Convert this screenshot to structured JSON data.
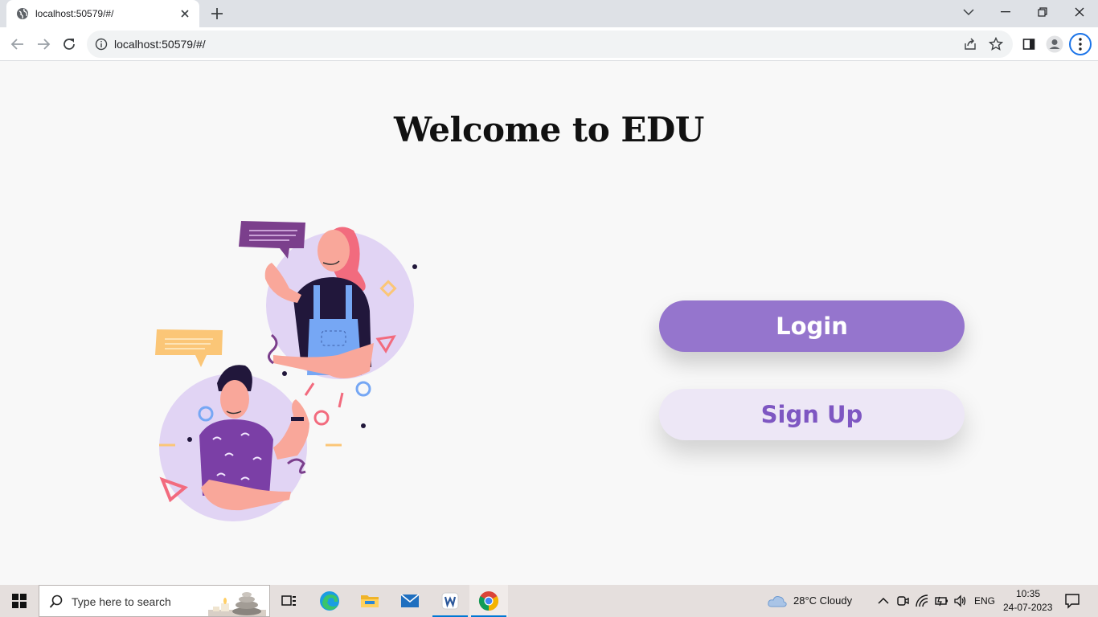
{
  "browser": {
    "tab_title": "localhost:50579/#/",
    "url": "localhost:50579/#/",
    "icons": [
      "globe-icon",
      "close-icon",
      "plus-icon",
      "chevron-down-icon",
      "minimize-icon",
      "restore-icon",
      "back-icon",
      "forward-icon",
      "reload-icon",
      "info-icon",
      "share-icon",
      "star-icon",
      "side-panel-icon",
      "profile-icon",
      "menu-icon"
    ]
  },
  "page": {
    "heading": "Welcome to EDU",
    "login_label": "Login",
    "signup_label": "Sign Up",
    "colors": {
      "primary": "#9575cd",
      "secondary": "#ede7f6",
      "secondary_text": "#7e57c2"
    }
  },
  "taskbar": {
    "search_placeholder": "Type here to search",
    "weather": "28°C  Cloudy",
    "language": "ENG",
    "time": "10:35",
    "date": "24-07-2023"
  }
}
